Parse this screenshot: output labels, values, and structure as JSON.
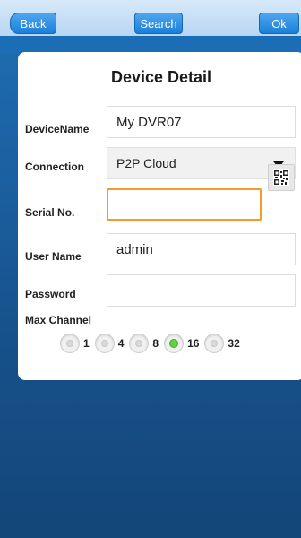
{
  "nav": {
    "back_label": "Back",
    "search_label": "Search",
    "ok_label": "Ok"
  },
  "form": {
    "title": "Device Detail",
    "device_name": {
      "label": "DeviceName",
      "value": "My DVR07"
    },
    "connection": {
      "label": "Connection",
      "value": "P2P Cloud"
    },
    "serial": {
      "label": "Serial No.",
      "value": ""
    },
    "username": {
      "label": "User Name",
      "value": "admin"
    },
    "password": {
      "label": "Password",
      "value": ""
    },
    "max_channel": {
      "label": "Max Channel",
      "options": [
        "1",
        "4",
        "8",
        "16",
        "32"
      ],
      "selected": "16"
    }
  },
  "colors": {
    "accent": "#1b7fd8",
    "focus": "#f39c2d",
    "selected_radio": "#5fd23e"
  }
}
